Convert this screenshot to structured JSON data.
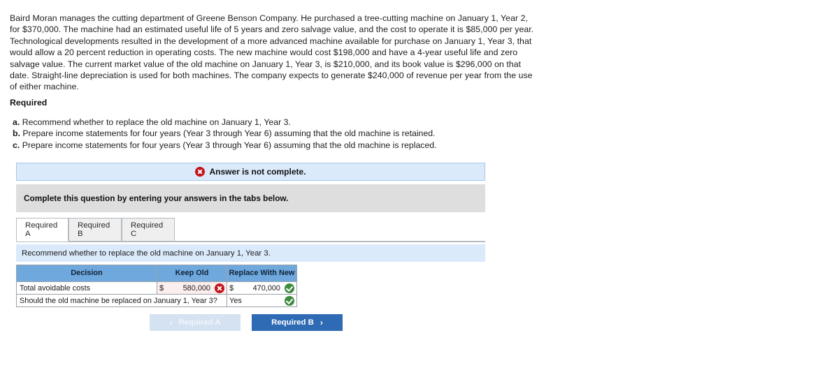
{
  "problem": {
    "narrative": "Baird Moran manages the cutting department of Greene Benson Company. He purchased a tree-cutting machine on January 1, Year 2, for $370,000. The machine had an estimated useful life of 5 years and zero salvage value, and the cost to operate it is $85,000 per year. Technological developments resulted in the development of a more advanced machine available for purchase on January 1, Year 3, that would allow a 20 percent reduction in operating costs. The new machine would cost $198,000 and have a 4-year useful life and zero salvage value. The current market value of the old machine on January 1, Year 3, is $210,000, and its book value is $296,000 on that date. Straight-line depreciation is used for both machines. The company expects to generate $240,000 of revenue per year from the use of either machine."
  },
  "required": {
    "heading": "Required",
    "items": [
      {
        "label": "a.",
        "text": "Recommend whether to replace the old machine on January 1, Year 3."
      },
      {
        "label": "b.",
        "text": "Prepare income statements for four years (Year 3 through Year 6) assuming that the old machine is retained."
      },
      {
        "label": "c.",
        "text": "Prepare income statements for four years (Year 3 through Year 6) assuming that the old machine is replaced."
      }
    ]
  },
  "banner": {
    "icon": "error-x-icon",
    "text": "Answer is not complete."
  },
  "instruction": {
    "text": "Complete this question by entering your answers in the tabs below."
  },
  "tabs": [
    {
      "label": "Required A",
      "active": true
    },
    {
      "label": "Required B",
      "active": false
    },
    {
      "label": "Required C",
      "active": false
    }
  ],
  "sub_instruction": {
    "text": "Recommend whether to replace the old machine on January 1, Year 3."
  },
  "answer_table": {
    "headers": [
      "Decision",
      "Keep Old",
      "Replace With New"
    ],
    "rows": [
      {
        "label": "Total avoidable costs",
        "keep_old": {
          "currency": "$",
          "value": "580,000",
          "status": "incorrect"
        },
        "replace_new": {
          "currency": "$",
          "value": "470,000",
          "status": "correct"
        }
      },
      {
        "label": "Should the old machine be replaced on January 1, Year 3?",
        "answer": {
          "value": "Yes",
          "status": "correct"
        }
      }
    ]
  },
  "navigation": {
    "prev_label": "Required A",
    "prev_chevron": "‹",
    "next_label": "Required B",
    "next_chevron": "›"
  },
  "colors": {
    "banner_bg": "#dbeafb",
    "banner_border": "#a6c8e8",
    "grey_bar": "#dedede",
    "table_header": "#6fa8dc",
    "wrong_cell": "#fdeeee",
    "error_red": "#c3161c",
    "correct_green": "#3d8b3d",
    "next_button": "#2f6bb5",
    "prev_button": "#d5e2f2"
  }
}
